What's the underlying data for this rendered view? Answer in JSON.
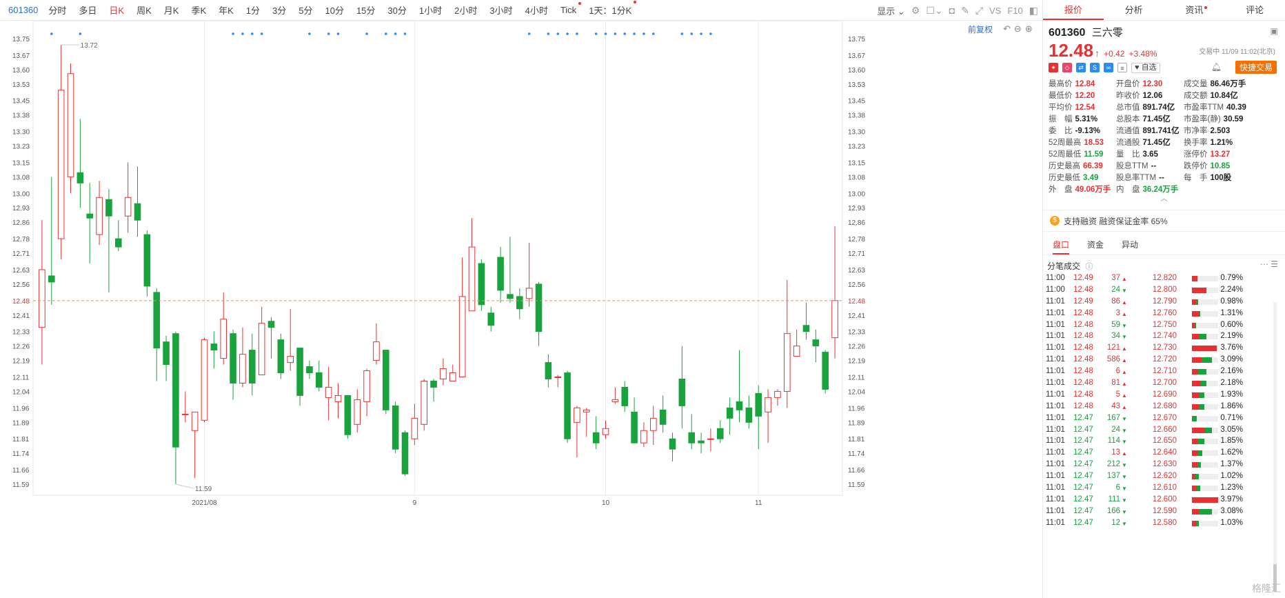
{
  "toolbar": {
    "code": "601360",
    "periods": [
      "分时",
      "多日",
      "日K",
      "周K",
      "月K",
      "季K",
      "年K",
      "1分",
      "3分",
      "5分",
      "10分",
      "15分",
      "30分",
      "1小时",
      "2小时",
      "3小时",
      "4小时",
      "Tick",
      "1天：1分K"
    ],
    "active_period": "日K",
    "display_label": "显示",
    "vs_label": "VS",
    "f10_label": "F10"
  },
  "chart": {
    "adjust_label": "前复权",
    "high_label": "13.72",
    "low_label": "11.59",
    "current_line_value": "12.48",
    "accent_up": "#e93030",
    "accent_down": "#18a33c"
  },
  "chart_data": {
    "type": "candlestick",
    "y_ticks": [
      "13.75",
      "13.67",
      "13.60",
      "13.53",
      "13.45",
      "13.38",
      "13.30",
      "13.23",
      "13.15",
      "13.08",
      "13.00",
      "12.93",
      "12.86",
      "12.78",
      "12.71",
      "12.63",
      "12.56",
      "12.48",
      "12.41",
      "12.33",
      "12.26",
      "12.19",
      "12.11",
      "12.04",
      "11.96",
      "11.89",
      "11.81",
      "11.74",
      "11.66",
      "11.59"
    ],
    "ylim": [
      11.55,
      13.79
    ],
    "x_labels": [
      "2021/08",
      "9",
      "10",
      "11"
    ],
    "x_label_index": [
      17,
      39,
      59,
      75
    ],
    "candles": [
      [
        12.35,
        12.63,
        12.87,
        12.17
      ],
      [
        12.6,
        12.57,
        13.08,
        12.46
      ],
      [
        12.78,
        13.5,
        13.72,
        12.68
      ],
      [
        13.08,
        13.58,
        13.63,
        13.0
      ],
      [
        13.1,
        13.05,
        13.36,
        12.93
      ],
      [
        12.9,
        12.88,
        13.05,
        12.66
      ],
      [
        12.8,
        12.98,
        13.06,
        12.75
      ],
      [
        12.97,
        12.89,
        13.02,
        12.52
      ],
      [
        12.78,
        12.74,
        12.87,
        12.72
      ],
      [
        12.89,
        12.98,
        13.15,
        12.81
      ],
      [
        12.95,
        12.87,
        13.13,
        12.79
      ],
      [
        12.8,
        12.55,
        12.82,
        12.5
      ],
      [
        12.52,
        12.25,
        12.54,
        12.09
      ],
      [
        12.28,
        12.17,
        12.31,
        12.09
      ],
      [
        12.32,
        11.77,
        12.33,
        11.59
      ],
      [
        11.93,
        11.93,
        12.04,
        11.89
      ],
      [
        11.85,
        11.94,
        11.94,
        11.62
      ],
      [
        11.9,
        12.29,
        12.3,
        11.89
      ],
      [
        12.27,
        12.24,
        12.33,
        12.15
      ],
      [
        12.2,
        12.39,
        12.52,
        12.17
      ],
      [
        12.32,
        12.08,
        12.34,
        12.0
      ],
      [
        12.08,
        12.22,
        12.35,
        12.06
      ],
      [
        12.24,
        12.08,
        12.32,
        12.02
      ],
      [
        12.12,
        12.37,
        12.45,
        12.12
      ],
      [
        12.38,
        12.35,
        12.4,
        12.2
      ],
      [
        12.29,
        12.13,
        12.32,
        12.1
      ],
      [
        12.18,
        12.21,
        12.44,
        12.14
      ],
      [
        12.25,
        12.02,
        12.25,
        11.97
      ],
      [
        12.16,
        12.13,
        12.19,
        12.1
      ],
      [
        12.13,
        12.06,
        12.19,
        12.04
      ],
      [
        12.01,
        12.06,
        12.16,
        11.9
      ],
      [
        11.99,
        12.02,
        12.08,
        11.91
      ],
      [
        12.02,
        11.83,
        12.02,
        11.81
      ],
      [
        11.88,
        12.0,
        12.05,
        11.84
      ],
      [
        11.99,
        12.14,
        12.15,
        11.92
      ],
      [
        12.19,
        12.28,
        12.37,
        12.17
      ],
      [
        12.24,
        11.95,
        12.24,
        11.93
      ],
      [
        11.97,
        11.76,
        11.99,
        11.74
      ],
      [
        11.84,
        11.64,
        11.85,
        11.63
      ],
      [
        11.81,
        11.91,
        11.98,
        11.78
      ],
      [
        11.88,
        12.09,
        12.1,
        11.85
      ],
      [
        12.09,
        12.06,
        12.1,
        11.99
      ],
      [
        12.1,
        12.15,
        12.2,
        12.07
      ],
      [
        12.09,
        12.13,
        12.17,
        12.09
      ],
      [
        12.11,
        12.5,
        12.69,
        12.11
      ],
      [
        12.43,
        12.74,
        12.88,
        12.44
      ],
      [
        12.66,
        12.46,
        12.68,
        12.43
      ],
      [
        12.42,
        12.36,
        12.45,
        12.33
      ],
      [
        12.69,
        12.53,
        12.74,
        12.47
      ],
      [
        12.51,
        12.49,
        12.79,
        12.47
      ],
      [
        12.5,
        12.44,
        12.54,
        12.39
      ],
      [
        12.49,
        12.54,
        12.76,
        12.45
      ],
      [
        12.56,
        12.33,
        12.57,
        12.26
      ],
      [
        12.18,
        12.1,
        12.22,
        12.06
      ],
      [
        12.11,
        12.11,
        12.12,
        12.06
      ],
      [
        12.13,
        11.81,
        12.14,
        11.79
      ],
      [
        11.89,
        11.96,
        11.97,
        11.72
      ],
      [
        11.94,
        11.95,
        11.96,
        11.82
      ],
      [
        11.84,
        11.79,
        11.92,
        11.76
      ],
      [
        11.83,
        11.86,
        11.9,
        11.81
      ],
      [
        11.99,
        12.0,
        12.06,
        11.98
      ],
      [
        12.06,
        11.97,
        12.09,
        11.94
      ],
      [
        11.94,
        11.79,
        12.01,
        11.79
      ],
      [
        11.79,
        11.85,
        11.89,
        11.77
      ],
      [
        11.85,
        11.91,
        11.97,
        11.78
      ],
      [
        11.95,
        11.88,
        12.02,
        11.84
      ],
      [
        11.81,
        11.76,
        11.84,
        11.7
      ],
      [
        12.1,
        11.97,
        12.26,
        11.86
      ],
      [
        11.84,
        11.79,
        11.93,
        11.76
      ],
      [
        11.8,
        11.79,
        11.84,
        11.74
      ],
      [
        11.81,
        11.81,
        11.86,
        11.75
      ],
      [
        11.86,
        11.81,
        11.9,
        11.79
      ],
      [
        11.96,
        11.91,
        12.01,
        11.83
      ],
      [
        11.99,
        11.95,
        12.24,
        11.89
      ],
      [
        11.96,
        11.89,
        12.02,
        11.86
      ],
      [
        12.03,
        11.92,
        12.07,
        11.76
      ],
      [
        11.94,
        12.01,
        12.05,
        11.79
      ],
      [
        12.01,
        12.04,
        12.05,
        11.97
      ],
      [
        12.04,
        12.32,
        12.58,
        11.96
      ],
      [
        12.21,
        12.26,
        12.34,
        12.21
      ],
      [
        12.36,
        12.33,
        12.47,
        12.29
      ],
      [
        12.29,
        12.26,
        12.34,
        12.18
      ],
      [
        12.23,
        12.05,
        12.24,
        12.03
      ],
      [
        12.3,
        12.48,
        12.84,
        12.2
      ]
    ]
  },
  "panel": {
    "tabs": [
      "报价",
      "分析",
      "资讯",
      "评论"
    ],
    "active_tab": "报价",
    "code": "601360",
    "name": "三六零",
    "price": "12.48",
    "change": "+0.42",
    "change_pct": "+3.48%",
    "trade_time": "交易中 11/09 11:02(北京)",
    "fav_label": "自选",
    "quick_trade": "快捷交易",
    "stats": [
      [
        [
          "最高价",
          "12.84",
          "red"
        ],
        [
          "开盘价",
          "12.30",
          "red"
        ],
        [
          "成交量",
          "86.46万手",
          "blk"
        ]
      ],
      [
        [
          "最低价",
          "12.20",
          "red"
        ],
        [
          "昨收价",
          "12.06",
          "blk"
        ],
        [
          "成交额",
          "10.84亿",
          "blk"
        ]
      ],
      [
        [
          "平均价",
          "12.54",
          "red"
        ],
        [
          "总市值",
          "891.74亿",
          "blk"
        ],
        [
          "市盈率TTM",
          "40.39",
          "blk"
        ]
      ],
      [
        [
          "振　幅",
          "5.31%",
          "blk"
        ],
        [
          "总股本",
          "71.45亿",
          "blk"
        ],
        [
          "市盈率(静)",
          "30.59",
          "blk"
        ]
      ],
      [
        [
          "委　比",
          "-9.13%",
          "blk"
        ],
        [
          "流通值",
          "891.741亿",
          "blk"
        ],
        [
          "市净率",
          "2.503",
          "blk"
        ]
      ],
      [
        [
          "52周最高",
          "18.53",
          "red"
        ],
        [
          "流通股",
          "71.45亿",
          "blk"
        ],
        [
          "换手率",
          "1.21%",
          "blk"
        ]
      ],
      [
        [
          "52周最低",
          "11.59",
          "green"
        ],
        [
          "量　比",
          "3.65",
          "blk"
        ],
        [
          "涨停价",
          "13.27",
          "red"
        ]
      ],
      [
        [
          "历史最高",
          "66.39",
          "red"
        ],
        [
          "股息TTM",
          "--",
          "blk"
        ],
        [
          "跌停价",
          "10.85",
          "green"
        ]
      ],
      [
        [
          "历史最低",
          "3.49",
          "green"
        ],
        [
          "股息率TTM",
          "--",
          "blk"
        ],
        [
          "每　手",
          "100股",
          "blk"
        ]
      ],
      [
        [
          "外　盘",
          "49.06万手",
          "red"
        ],
        [
          "内　盘",
          "36.24万手",
          "green"
        ],
        [
          "",
          "",
          "blk"
        ]
      ]
    ],
    "margin_text": "支持融资 融资保证金率 65%",
    "subtabs": [
      "盘口",
      "资金",
      "异动"
    ],
    "tick_title": "分笔成交",
    "ticks": [
      [
        "11:00",
        "12.49",
        "37",
        "up",
        "12.820",
        0.79,
        0.0,
        "0.79%"
      ],
      [
        "11:00",
        "12.48",
        "24",
        "down",
        "12.800",
        2.24,
        0.0,
        "2.24%"
      ],
      [
        "11:01",
        "12.49",
        "86",
        "up",
        "12.790",
        0.6,
        0.38,
        "0.98%"
      ],
      [
        "11:01",
        "12.48",
        "3",
        "up",
        "12.760",
        1.0,
        0.31,
        "1.31%"
      ],
      [
        "11:01",
        "12.48",
        "59",
        "down",
        "12.750",
        0.45,
        0.15,
        "0.60%"
      ],
      [
        "11:01",
        "12.48",
        "34",
        "down",
        "12.740",
        1.2,
        0.99,
        "2.19%"
      ],
      [
        "11:01",
        "12.48",
        "121",
        "up",
        "12.730",
        3.76,
        0.0,
        "3.76%"
      ],
      [
        "11:01",
        "12.48",
        "586",
        "up",
        "12.720",
        1.5,
        1.59,
        "3.09%"
      ],
      [
        "11:01",
        "12.48",
        "6",
        "up",
        "12.710",
        0.9,
        1.26,
        "2.16%"
      ],
      [
        "11:01",
        "12.48",
        "81",
        "up",
        "12.700",
        1.3,
        0.88,
        "2.18%"
      ],
      [
        "11:01",
        "12.48",
        "5",
        "up",
        "12.690",
        1.2,
        0.73,
        "1.93%"
      ],
      [
        "11:01",
        "12.48",
        "43",
        "up",
        "12.680",
        1.0,
        0.86,
        "1.86%"
      ],
      [
        "11:01",
        "12.47",
        "167",
        "down",
        "12.670",
        0.0,
        0.71,
        "0.71%"
      ],
      [
        "11:01",
        "12.47",
        "24",
        "down",
        "12.660",
        2.0,
        1.05,
        "3.05%"
      ],
      [
        "11:01",
        "12.47",
        "114",
        "down",
        "12.650",
        0.85,
        1.0,
        "1.85%"
      ],
      [
        "11:01",
        "12.47",
        "13",
        "up",
        "12.640",
        0.9,
        0.72,
        "1.62%"
      ],
      [
        "11:01",
        "12.47",
        "212",
        "down",
        "12.630",
        0.8,
        0.57,
        "1.37%"
      ],
      [
        "11:01",
        "12.47",
        "137",
        "down",
        "12.620",
        0.52,
        0.5,
        "1.02%"
      ],
      [
        "11:01",
        "12.47",
        "6",
        "down",
        "12.610",
        0.73,
        0.5,
        "1.23%"
      ],
      [
        "11:01",
        "12.47",
        "111",
        "down",
        "12.600",
        3.97,
        0.0,
        "3.97%"
      ],
      [
        "11:01",
        "12.47",
        "166",
        "down",
        "12.590",
        1.0,
        2.08,
        "3.08%"
      ],
      [
        "11:01",
        "12.47",
        "12",
        "down",
        "12.580",
        0.6,
        0.43,
        "1.03%"
      ]
    ],
    "watermark": "格隆汇"
  }
}
